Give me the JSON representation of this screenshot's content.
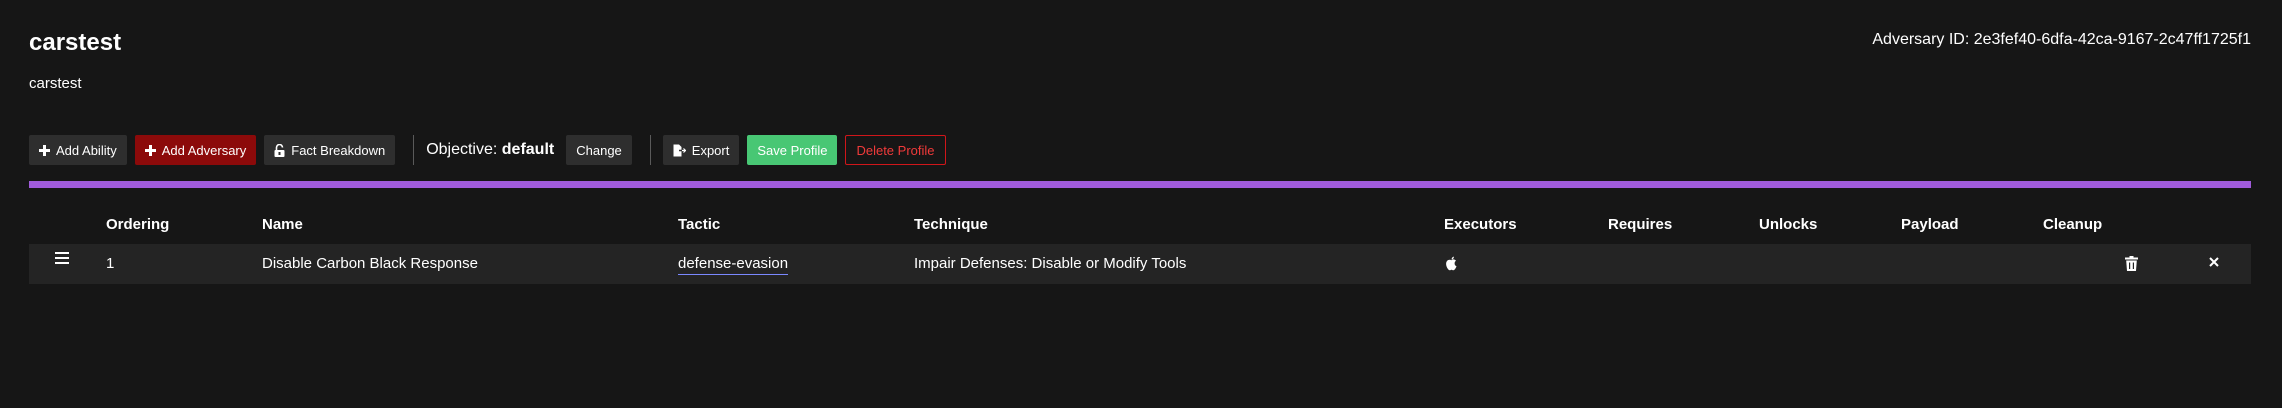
{
  "header": {
    "title": "carstest",
    "subtitle": "carstest",
    "adversary_id": "Adversary ID: 2e3fef40-6dfa-42ca-9167-2c47ff1725f1"
  },
  "toolbar": {
    "add_ability": "Add Ability",
    "add_adversary": "Add Adversary",
    "fact_breakdown": "Fact Breakdown",
    "objective_label": "Objective:",
    "objective_value": "default",
    "change": "Change",
    "export": "Export",
    "save_profile": "Save Profile",
    "delete_profile": "Delete Profile"
  },
  "colors": {
    "accent_bar": "#a05bdb",
    "add_adversary": "#8c0a0a",
    "save": "#48c774",
    "delete": "#d0161a"
  },
  "table": {
    "headers": {
      "ordering": "Ordering",
      "name": "Name",
      "tactic": "Tactic",
      "technique": "Technique",
      "executors": "Executors",
      "requires": "Requires",
      "unlocks": "Unlocks",
      "payload": "Payload",
      "cleanup": "Cleanup"
    },
    "rows": [
      {
        "drag_icon": "drag-handle-icon",
        "ordering": "1",
        "name": "Disable Carbon Black Response",
        "tactic": "defense-evasion",
        "technique": "Impair Defenses: Disable or Modify Tools",
        "executor_icon": "apple-icon",
        "cleanup_icon": "trash-icon",
        "remove_icon": "close-icon"
      }
    ]
  }
}
